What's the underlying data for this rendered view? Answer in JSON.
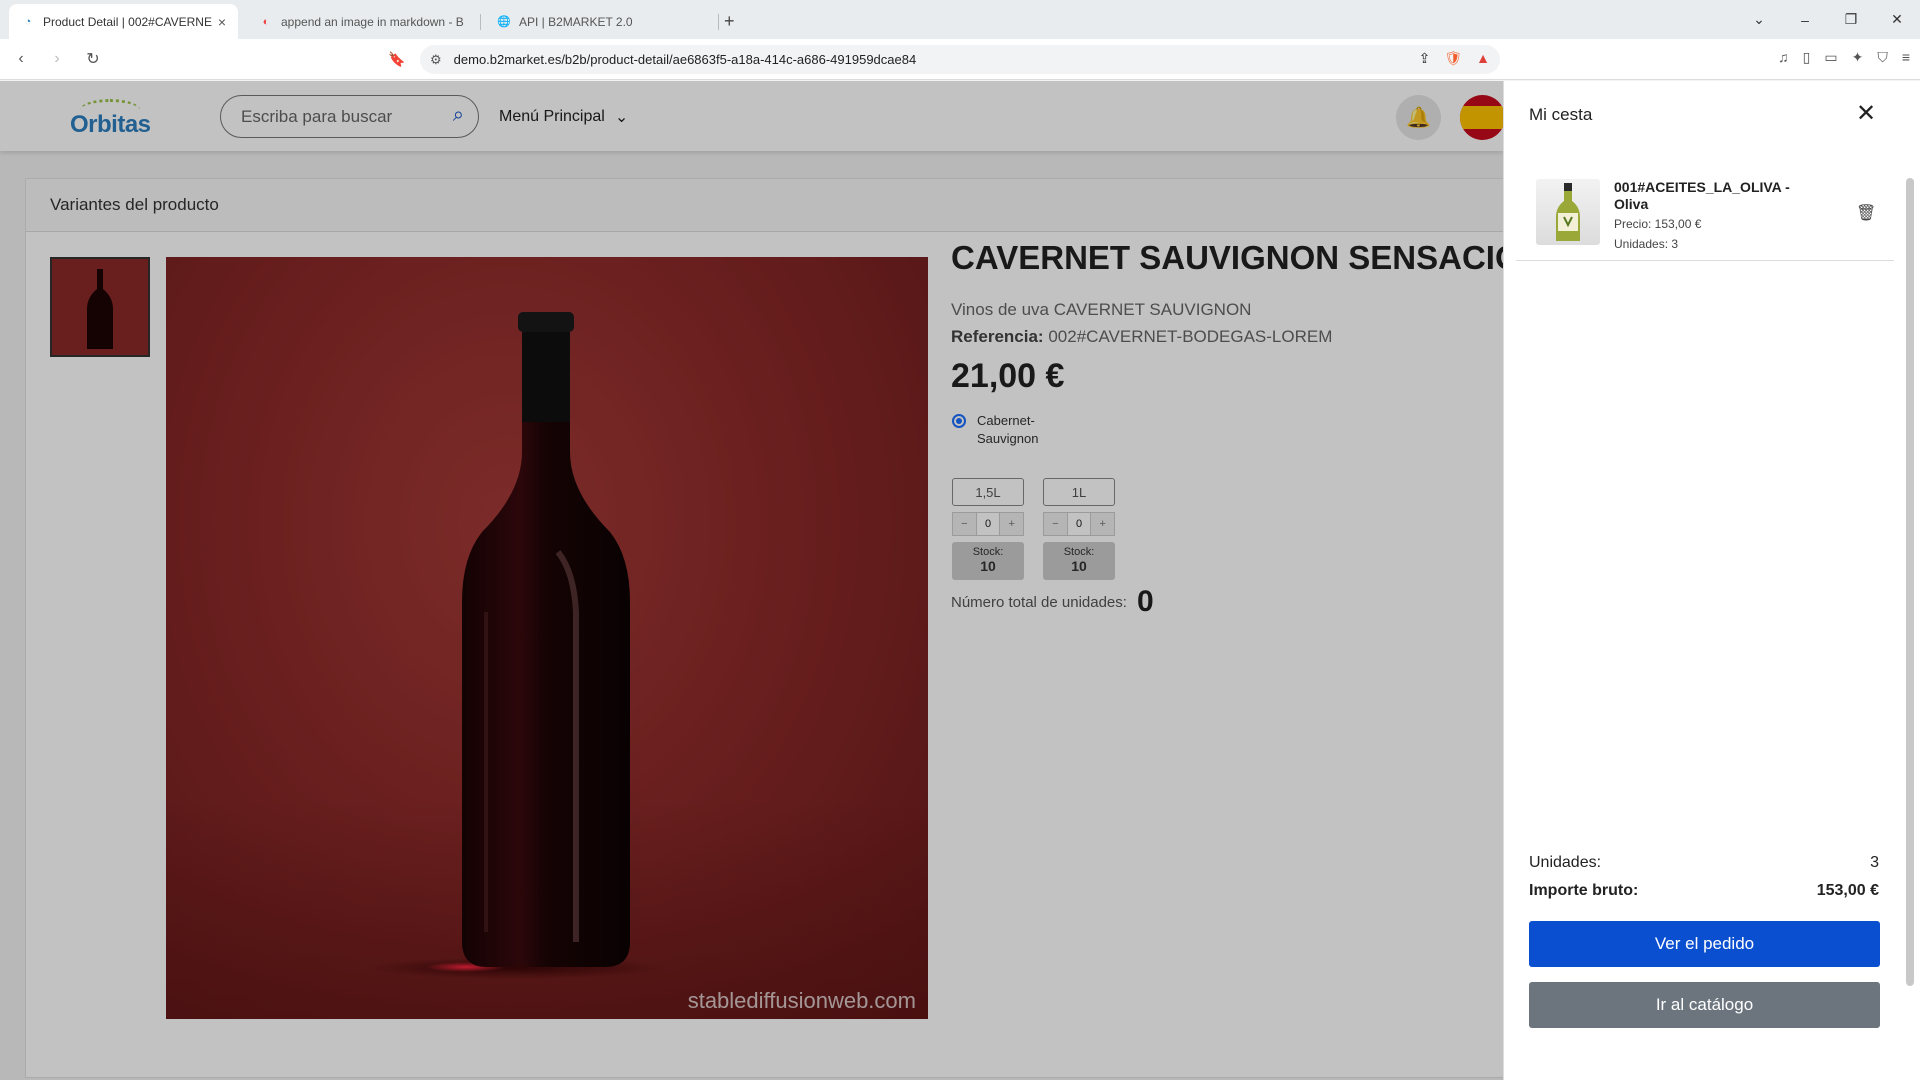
{
  "browser": {
    "tabs": [
      {
        "title": "Product Detail | 002#CAVERNE",
        "active": true
      },
      {
        "title": "append an image in markdown - Br",
        "active": false
      },
      {
        "title": "API | B2MARKET 2.0",
        "active": false
      }
    ],
    "new_tab": "+",
    "url": "demo.b2market.es/b2b/product-detail/ae6863f5-a18a-414c-a686-491959dcae84"
  },
  "header": {
    "logo_text": "Orbitas",
    "search_placeholder": "Escriba para buscar",
    "menu_label": "Menú Principal"
  },
  "product": {
    "section_title": "Variantes del producto",
    "title": "CAVERNET SAUVIGNON SENSACIÓN",
    "subtitle": "Vinos de uva CAVERNET SAUVIGNON",
    "reference_label": "Referencia:",
    "reference_value": "002#CAVERNET-BODEGAS-LOREM",
    "price": "21,00 €",
    "option_label": "Cabernet-Sauvignon",
    "watermark": "stablediffusionweb.com",
    "variants": [
      {
        "size": "1,5L",
        "qty": "0",
        "stock_label": "Stock:",
        "stock": "10"
      },
      {
        "size": "1L",
        "qty": "0",
        "stock_label": "Stock:",
        "stock": "10"
      }
    ],
    "total_label": "Número total de unidades:",
    "total_value": "0"
  },
  "cart": {
    "title": "Mi cesta",
    "item": {
      "name": "001#ACEITES_LA_OLIVA - Oliva",
      "price": "Precio: 153,00 €",
      "units": "Unidades: 3"
    },
    "units_label": "Unidades:",
    "units_value": "3",
    "gross_label": "Importe bruto:",
    "gross_value": "153,00 €",
    "primary_button": "Ver el pedido",
    "secondary_button": "Ir al catálogo"
  },
  "colors": {
    "primary": "#0a4fd0",
    "secondary": "#6c757d",
    "wine": "#8c2a29"
  }
}
